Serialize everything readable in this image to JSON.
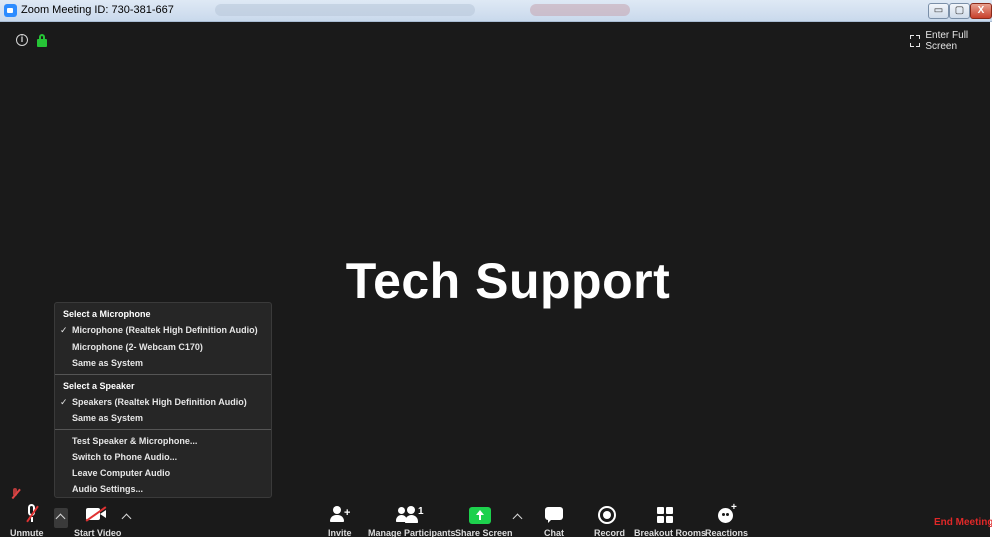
{
  "window": {
    "title": "Zoom Meeting ID: 730-381-667",
    "controls": {
      "minimize_glyph": "▭",
      "maximize_glyph": "▢",
      "close_glyph": "X"
    }
  },
  "stage": {
    "participant_name": "Tech Support",
    "enter_full_screen": "Enter Full Screen",
    "info_glyph": "i"
  },
  "audio_menu": {
    "microphone_header": "Select a Microphone",
    "microphones": [
      {
        "label": "Microphone (Realtek High Definition Audio)",
        "selected": true
      },
      {
        "label": "Microphone (2- Webcam C170)",
        "selected": false
      },
      {
        "label": "Same as System",
        "selected": false
      }
    ],
    "speaker_header": "Select a Speaker",
    "speakers": [
      {
        "label": "Speakers (Realtek High Definition Audio)",
        "selected": true
      },
      {
        "label": "Same as System",
        "selected": false
      }
    ],
    "actions": [
      {
        "label": "Test Speaker & Microphone..."
      },
      {
        "label": "Switch to Phone Audio..."
      },
      {
        "label": "Leave Computer Audio"
      },
      {
        "label": "Audio Settings..."
      }
    ],
    "check_glyph": "✓"
  },
  "toolbar": {
    "unmute": "Unmute",
    "start_video": "Start Video",
    "invite": "Invite",
    "invite_plus": "+",
    "manage_participants": "Manage Participants",
    "participant_count": "1",
    "share_screen": "Share Screen",
    "chat": "Chat",
    "record": "Record",
    "breakout_rooms": "Breakout Rooms",
    "reactions": "Reactions",
    "reactions_plus": "+",
    "end_meeting": "End Meeting"
  },
  "colors": {
    "background": "#1a1a1a",
    "menu_background": "#262626",
    "share_green": "#1dd14d",
    "end_red": "#e02828",
    "lock_green": "#26c436",
    "mute_red": "#e03232"
  },
  "icons": [
    "zoom-app-icon",
    "info-icon",
    "lock-icon",
    "fullscreen-icon",
    "mic-muted-icon",
    "video-off-icon",
    "invite-icon",
    "participants-icon",
    "share-screen-icon",
    "chat-icon",
    "record-icon",
    "breakout-rooms-icon",
    "reactions-icon",
    "chevron-up-icon",
    "checkmark-icon"
  ]
}
